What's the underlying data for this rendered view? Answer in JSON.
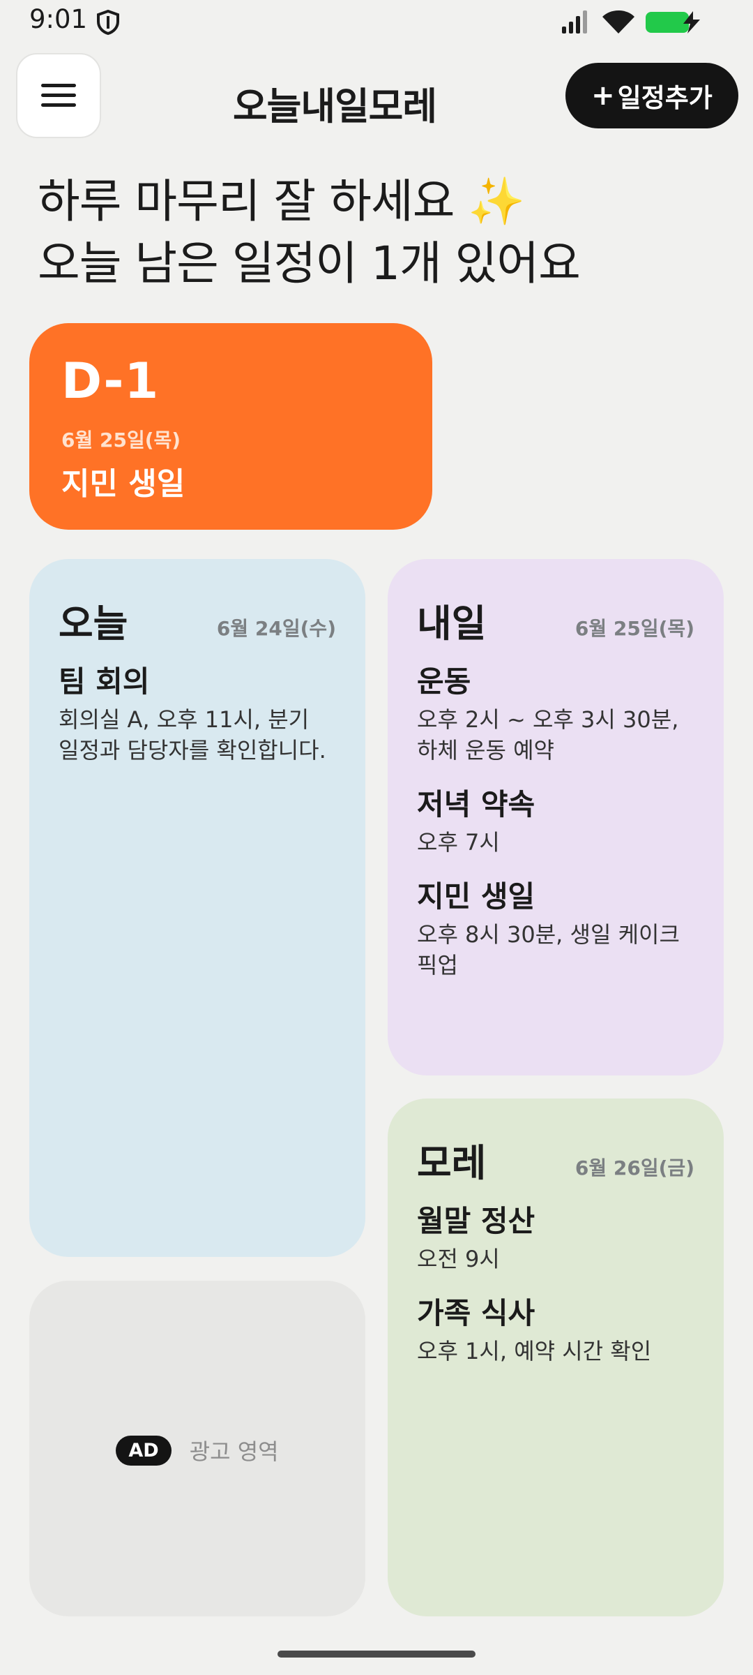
{
  "status_bar": {
    "time": "9:01"
  },
  "header": {
    "app_title": "오늘내일모레",
    "add_button_label": "일정추가",
    "add_button_icon": "+"
  },
  "greeting": {
    "line1": "하루 마무리 잘 하세요 ✨",
    "line2": "오늘 남은 일정이 1개 있어요"
  },
  "dday": {
    "count": "D-1",
    "date": "6월 25일(목)",
    "title": "지민 생일",
    "color": "#ff7226"
  },
  "today": {
    "label": "오늘",
    "date": "6월 24일(수)",
    "color": "#d9e9f0",
    "events": [
      {
        "title": "팀 회의",
        "desc": "회의실 A, 오후 11시, 분기 일정과 담당자를 확인합니다."
      }
    ]
  },
  "tomorrow": {
    "label": "내일",
    "date": "6월 25일(목)",
    "color": "#ebe0f3",
    "events": [
      {
        "title": "운동",
        "desc": "오후 2시 ~ 오후 3시 30분, 하체 운동 예약"
      },
      {
        "title": "저녁 약속",
        "desc": "오후 7시"
      },
      {
        "title": "지민 생일",
        "desc": "오후 8시 30분, 생일 케이크 픽업"
      }
    ]
  },
  "dayafter": {
    "label": "모레",
    "date": "6월 26일(금)",
    "color": "#dfe9d4",
    "events": [
      {
        "title": "월말 정산",
        "desc": "오전 9시"
      },
      {
        "title": "가족 식사",
        "desc": "오후 1시, 예약 시간 확인"
      }
    ]
  },
  "ad": {
    "badge": "AD",
    "text": "광고 영역"
  },
  "icons": {
    "menu": "hamburger-menu-icon",
    "shield": "shield-icon",
    "signal": "cellular-signal-icon",
    "wifi": "wifi-icon",
    "battery": "battery-charging-icon"
  }
}
